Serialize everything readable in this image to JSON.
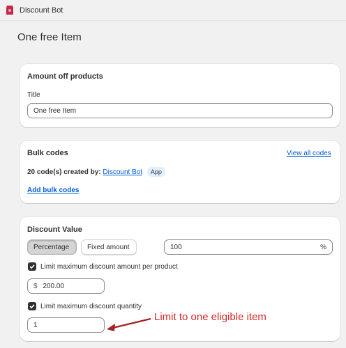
{
  "app": {
    "name": "Discount Bot"
  },
  "page": {
    "title": "One free Item"
  },
  "amount_card": {
    "heading": "Amount off products",
    "title_label": "Title",
    "title_value": "One free Item"
  },
  "bulk_card": {
    "heading": "Bulk codes",
    "view_all": "View all codes",
    "created_prefix": "20 code(s) created by:",
    "created_by": "Discount Bot",
    "badge": "App",
    "add_link": "Add bulk codes"
  },
  "discount_card": {
    "heading": "Discount Value",
    "seg_percentage": "Percentage",
    "seg_fixed": "Fixed amount",
    "value": "100",
    "value_suffix": "%",
    "limit_amount_label": "Limit maximum discount amount per product",
    "currency_prefix": "$",
    "limit_amount_value": "200.00",
    "limit_qty_label": "Limit maximum discount quantity",
    "limit_qty_value": "1"
  },
  "annotation": {
    "text": "Limit to one eligible item",
    "color": "#d12a2a"
  },
  "colors": {
    "link": "#005bd3",
    "app_icon": "#c22a4b",
    "checkbox": "#303030"
  }
}
